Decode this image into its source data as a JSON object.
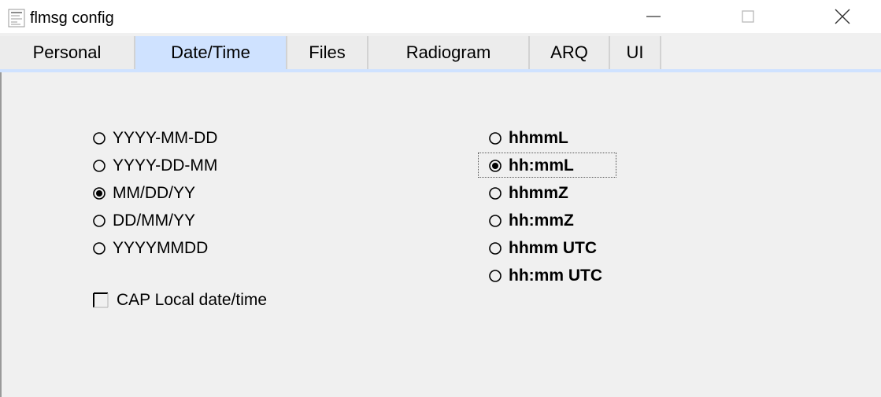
{
  "window": {
    "title": "flmsg config",
    "controls": {
      "minimize": "minimize-icon",
      "maximize": "maximize-icon",
      "close": "close-icon"
    }
  },
  "tabs": [
    {
      "label": "Personal",
      "active": false
    },
    {
      "label": "Date/Time",
      "active": true
    },
    {
      "label": "Files",
      "active": false
    },
    {
      "label": "Radiogram",
      "active": false
    },
    {
      "label": "ARQ",
      "active": false
    },
    {
      "label": "UI",
      "active": false
    }
  ],
  "date_formats": [
    {
      "label": "YYYY-MM-DD",
      "selected": false
    },
    {
      "label": "YYYY-DD-MM",
      "selected": false
    },
    {
      "label": "MM/DD/YY",
      "selected": true
    },
    {
      "label": "DD/MM/YY",
      "selected": false
    },
    {
      "label": "YYYYMMDD",
      "selected": false
    }
  ],
  "time_formats": [
    {
      "label": "hhmmL",
      "selected": false
    },
    {
      "label": "hh:mmL",
      "selected": true
    },
    {
      "label": "hhmmZ",
      "selected": false
    },
    {
      "label": "hh:mmZ",
      "selected": false
    },
    {
      "label": "hhmm UTC",
      "selected": false
    },
    {
      "label": "hh:mm UTC",
      "selected": false
    }
  ],
  "cap_local": {
    "label": "CAP Local date/time",
    "checked": false
  },
  "colors": {
    "active_tab": "#cfe2ff",
    "background": "#f0f0f0"
  }
}
